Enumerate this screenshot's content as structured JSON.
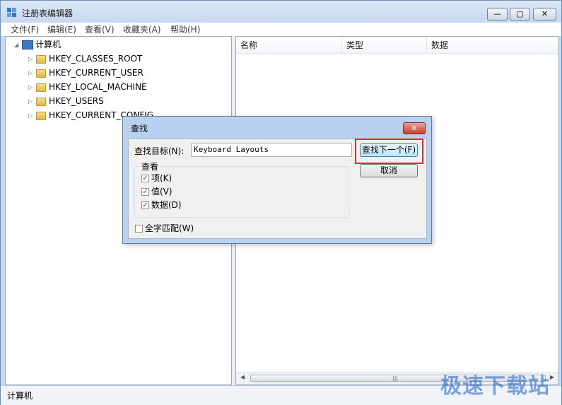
{
  "window": {
    "title": "注册表编辑器",
    "minimize_glyph": "—",
    "maximize_glyph": "▢",
    "close_glyph": "✕"
  },
  "menu": [
    "文件(F)",
    "编辑(E)",
    "查看(V)",
    "收藏夹(A)",
    "帮助(H)"
  ],
  "tree": {
    "root": "计算机",
    "items": [
      "HKEY_CLASSES_ROOT",
      "HKEY_CURRENT_USER",
      "HKEY_LOCAL_MACHINE",
      "HKEY_USERS",
      "HKEY_CURRENT_CONFIG"
    ]
  },
  "list": {
    "columns": [
      "名称",
      "类型",
      "数据"
    ]
  },
  "status": {
    "text": "计算机"
  },
  "watermark": "极速下载站",
  "find_dialog": {
    "title": "查找",
    "find_label": "查找目标(N):",
    "find_value": "Keyboard Layouts",
    "find_next_label": "查找下一个(F)",
    "cancel_label": "取消",
    "group_label": "查看",
    "options": [
      {
        "label": "项(K)",
        "checked": true
      },
      {
        "label": "值(V)",
        "checked": true
      },
      {
        "label": "数据(D)",
        "checked": true
      }
    ],
    "whole_word_label": "全字匹配(W)",
    "whole_word_checked": false
  },
  "colors": {
    "highlight": "#e02a2a",
    "watermark": "#1a5fc0"
  }
}
